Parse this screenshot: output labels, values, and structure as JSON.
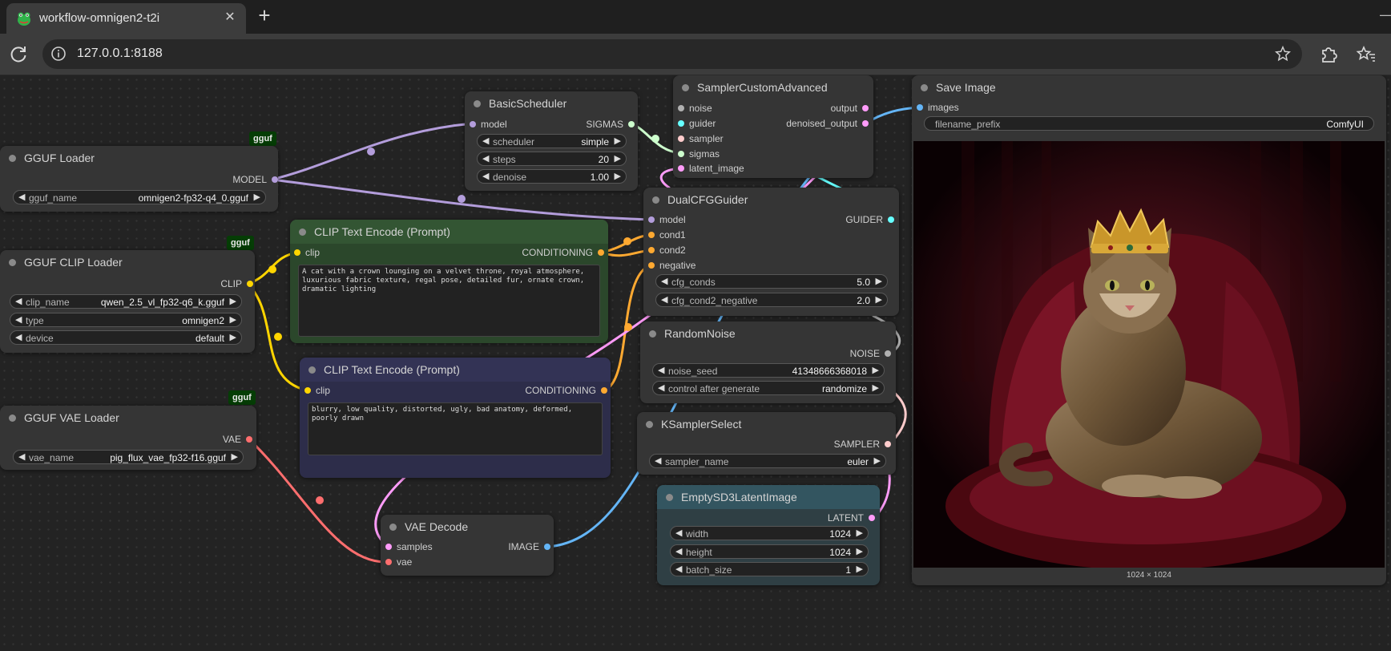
{
  "browser": {
    "tab_title": "workflow-omnigen2-t2i",
    "tab_close": "✕",
    "new_tab": "+",
    "minimize": "—",
    "url": "127.0.0.1:8188"
  },
  "colors": {
    "model": "#b39ddb",
    "clip": "#ffd500",
    "vae": "#ff6e6e",
    "conditioning": "#ffa931",
    "sigmas": "#cdffcd",
    "noise": "#b0b0b0",
    "guider": "#66ffff",
    "sampler": "#ffcccc",
    "latent": "#ff9cf9",
    "image": "#64b5f6",
    "badge": "#053d05"
  },
  "nodes": {
    "gguf_loader": {
      "badge": "gguf",
      "title": "GGUF Loader",
      "out_model": "MODEL",
      "widgets": [
        {
          "name": "gguf_name",
          "value": "omnigen2-fp32-q4_0.gguf"
        }
      ]
    },
    "gguf_clip_loader": {
      "badge": "gguf",
      "title": "GGUF CLIP Loader",
      "out_clip": "CLIP",
      "widgets": [
        {
          "name": "clip_name",
          "value": "qwen_2.5_vl_fp32-q6_k.gguf"
        },
        {
          "name": "type",
          "value": "omnigen2"
        },
        {
          "name": "device",
          "value": "default"
        }
      ]
    },
    "gguf_vae_loader": {
      "badge": "gguf",
      "title": "GGUF VAE Loader",
      "out_vae": "VAE",
      "widgets": [
        {
          "name": "vae_name",
          "value": "pig_flux_vae_fp32-f16.gguf"
        }
      ]
    },
    "clip_pos": {
      "title": "CLIP Text Encode (Prompt)",
      "in_clip": "clip",
      "out_cond": "CONDITIONING",
      "text": "A cat with a crown lounging on a velvet throne, royal atmosphere, luxurious fabric texture, regal pose, detailed fur, ornate crown, dramatic lighting"
    },
    "clip_neg": {
      "title": "CLIP Text Encode (Prompt)",
      "in_clip": "clip",
      "out_cond": "CONDITIONING",
      "text": "blurry, low quality, distorted, ugly, bad anatomy, deformed, poorly drawn"
    },
    "basic_scheduler": {
      "title": "BasicScheduler",
      "in_model": "model",
      "out_sigmas": "SIGMAS",
      "widgets": [
        {
          "name": "scheduler",
          "value": "simple"
        },
        {
          "name": "steps",
          "value": "20"
        },
        {
          "name": "denoise",
          "value": "1.00"
        }
      ]
    },
    "sampler_custom": {
      "title": "SamplerCustomAdvanced",
      "in_noise": "noise",
      "in_guider": "guider",
      "in_sampler": "sampler",
      "in_sigmas": "sigmas",
      "in_latent": "latent_image",
      "out_output": "output",
      "out_denoised": "denoised_output"
    },
    "dual_cfg": {
      "title": "DualCFGGuider",
      "in_model": "model",
      "in_cond1": "cond1",
      "in_cond2": "cond2",
      "in_negative": "negative",
      "out_guider": "GUIDER",
      "widgets": [
        {
          "name": "cfg_conds",
          "value": "5.0"
        },
        {
          "name": "cfg_cond2_negative",
          "value": "2.0"
        }
      ]
    },
    "random_noise": {
      "title": "RandomNoise",
      "out_noise": "NOISE",
      "widgets": [
        {
          "name": "noise_seed",
          "value": "41348666368018"
        },
        {
          "name": "control after generate",
          "value": "randomize"
        }
      ]
    },
    "ksampler_select": {
      "title": "KSamplerSelect",
      "out_sampler": "SAMPLER",
      "widgets": [
        {
          "name": "sampler_name",
          "value": "euler"
        }
      ]
    },
    "empty_latent": {
      "title": "EmptySD3LatentImage",
      "out_latent": "LATENT",
      "widgets": [
        {
          "name": "width",
          "value": "1024"
        },
        {
          "name": "height",
          "value": "1024"
        },
        {
          "name": "batch_size",
          "value": "1"
        }
      ]
    },
    "vae_decode": {
      "title": "VAE Decode",
      "in_samples": "samples",
      "in_vae": "vae",
      "out_image": "IMAGE"
    },
    "save_image": {
      "title": "Save Image",
      "in_images": "images",
      "widgets": [
        {
          "name": "filename_prefix",
          "value": "ComfyUI"
        }
      ],
      "caption": "1024 × 1024"
    }
  },
  "arrows": {
    "left": "◀",
    "right": "▶"
  }
}
